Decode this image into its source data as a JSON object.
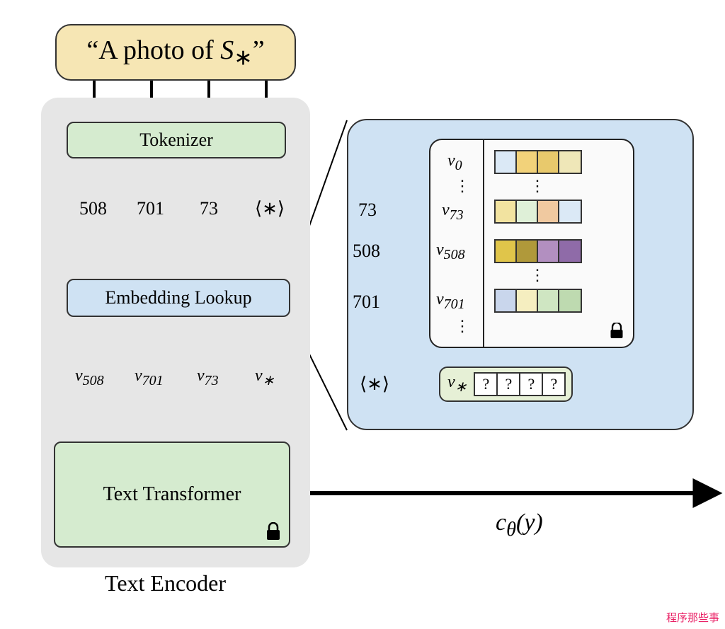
{
  "prompt": "“A photo of S*”",
  "blocks": {
    "tokenizer": "Tokenizer",
    "embed": "Embedding Lookup",
    "transformer": "Text Transformer",
    "encoder": "Text Encoder"
  },
  "tokens": [
    "508",
    "701",
    "73",
    "⟨∗⟩"
  ],
  "embeds": [
    "v₅₀₈",
    "v₇₀₁",
    "v₇₃",
    "v*"
  ],
  "left_inputs": [
    "73",
    "508",
    "701"
  ],
  "star_in": "⟨∗⟩",
  "lookup": {
    "rows": [
      {
        "label": "v₀",
        "colors": [
          "#dbe9f6",
          "#f2d27a",
          "#e8c96c",
          "#efe7b8"
        ]
      },
      {
        "label": "v₇₃",
        "colors": [
          "#f2e3a0",
          "#dff0d8",
          "#f0c9a0",
          "#dbe9f6"
        ]
      },
      {
        "label": "v₅₀₈",
        "colors": [
          "#e0c54a",
          "#b0993a",
          "#b28fc0",
          "#8f6ba8"
        ]
      },
      {
        "label": "v₇₀₁",
        "colors": [
          "#c9d6ec",
          "#f5eec0",
          "#cfe6c2",
          "#bedab0"
        ]
      }
    ],
    "vdots": "⋮"
  },
  "vstar": {
    "label": "v*",
    "cells": [
      "?",
      "?",
      "?",
      "?"
    ]
  },
  "output": "cθ(y)",
  "watermark": "程序那些事"
}
